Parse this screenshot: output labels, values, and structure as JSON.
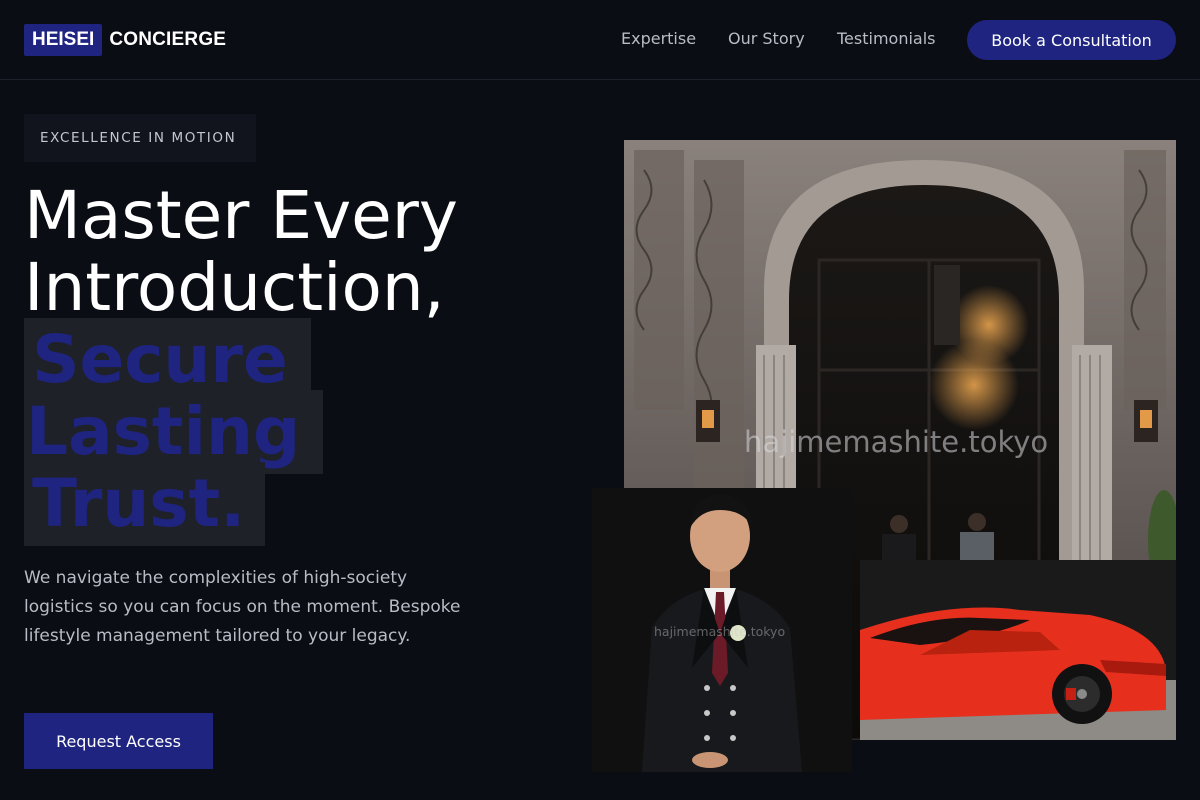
{
  "brand": {
    "badge": "HEISEI",
    "rest": "CONCIERGE"
  },
  "nav": {
    "links": [
      "Expertise",
      "Our Story",
      "Testimonials"
    ],
    "cta": "Book a Consultation"
  },
  "hero": {
    "eyebrow": "EXCELLENCE IN MOTION",
    "headline_lines": [
      "Master Every",
      "Introduction,"
    ],
    "accent_lines": [
      "Secure",
      "Lasting",
      "Trust."
    ],
    "description": "We navigate the complexities of high-society logistics so you can focus on the moment. Bespoke lifestyle management tailored to your legacy.",
    "button": "Request Access"
  },
  "images": {
    "main_watermark": "hajimemashite.tokyo",
    "portrait_watermark": "hajimemashite.tokyo"
  },
  "colors": {
    "background": "#0b0d14",
    "accent": "#1e2480",
    "accent_bg": "#1f2129",
    "text_muted": "#b9bcc6"
  }
}
